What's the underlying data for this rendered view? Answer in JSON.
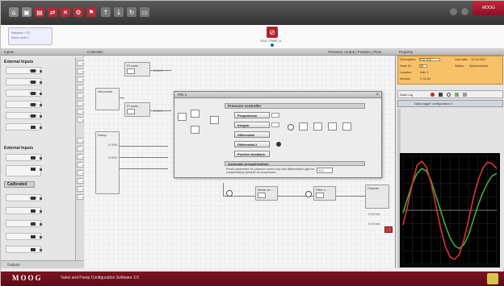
{
  "window": {
    "brand": "MOOG",
    "toolbar_icons": [
      "home-icon",
      "save-icon",
      "open-icon",
      "connect-icon",
      "disconnect-icon",
      "settings-icon",
      "up-arrow-icon",
      "down-arrow-icon",
      "refresh-icon",
      "monitor-icon"
    ]
  },
  "breadcrumb": {
    "line1": "Network / TO",
    "line2": "Servo axis 1"
  },
  "device": {
    "label": "VDU / PWR_D..."
  },
  "left_pane": {
    "header": "Inputs",
    "section1": "External Inputs",
    "section2": "External Inputs",
    "section3": "Calibrated",
    "footer": "Outputs",
    "signal_values": [
      "0.00%",
      "0.00%",
      "0.00%",
      "0.00%",
      "0.00%",
      "0.00%"
    ]
  },
  "canvas": {
    "header": "Controller",
    "header_right": "Pressure control | Position | Flow",
    "blocks": {
      "gen1": "PI contr...",
      "gen2": "PI contr...",
      "set_points": "Set points",
      "ramp": "Ramp",
      "pid_blk": "PID 1",
      "bottom1": "Mode ca...",
      "bottom2": "Filter c...",
      "outputs": "Outputs"
    },
    "values": [
      "0.00%",
      "0.00%",
      "0.00%",
      "0.00%",
      "0.00 bar",
      "0.00 bar"
    ]
  },
  "dialog": {
    "title": "PID 1",
    "section_header": "Pressure controller",
    "buttons": [
      "Proportional",
      "Integral",
      "Differential",
      "Differential 2",
      "Positive feedback"
    ],
    "option_header": "Automatic preoptimization",
    "option_text": "Preset parameters for pressure control loop with differentiation gain for compensating hydraulic oil compression",
    "option_value": "0.0"
  },
  "right_pane": {
    "header": "Property",
    "props": [
      {
        "label": "Description:",
        "value": "PID 2017",
        "label2": "Last date:",
        "value2": "12:10:2017"
      },
      {
        "label": "Node ID:",
        "value": "35",
        "label2": "Status:",
        "value2": "Synchronized"
      },
      {
        "label": "Location:",
        "value": "Axis 1"
      },
      {
        "label": "Version:",
        "value": "V 01.00"
      }
    ],
    "scope_title": "Data Log",
    "scope_sub": "Data logger configuration 1",
    "scope_toolbar_icons": [
      "record-icon",
      "stop-icon",
      "zoom-icon",
      "export-icon",
      "settings-icon"
    ]
  },
  "footer": {
    "text": "Valve and Pump Configuration Software 3.0"
  },
  "chart_data": {
    "type": "line",
    "title": "",
    "xlabel": "",
    "ylabel": "",
    "x": [
      0,
      1,
      2,
      3,
      4,
      5,
      6,
      7,
      8,
      9,
      10,
      11,
      12,
      13,
      14,
      15,
      16,
      17,
      18,
      19,
      20
    ],
    "series": [
      {
        "values": [
          -0.05,
          0.25,
          0.55,
          0.75,
          0.85,
          0.8,
          0.6,
          0.3,
          0.0,
          -0.3,
          -0.55,
          -0.72,
          -0.78,
          -0.7,
          -0.5,
          -0.2,
          0.1,
          0.35,
          0.55,
          0.7,
          0.75
        ],
        "color": "#3fae3a"
      },
      {
        "values": [
          -0.3,
          0.1,
          0.55,
          0.92,
          1.0,
          0.88,
          0.55,
          0.1,
          -0.35,
          -0.72,
          -0.95,
          -1.0,
          -0.9,
          -0.6,
          -0.2,
          0.25,
          0.6,
          0.85,
          0.98,
          0.95,
          0.85
        ],
        "color": "#d9342e"
      }
    ],
    "ylim": [
      -1.1,
      1.1
    ],
    "grid": true
  }
}
